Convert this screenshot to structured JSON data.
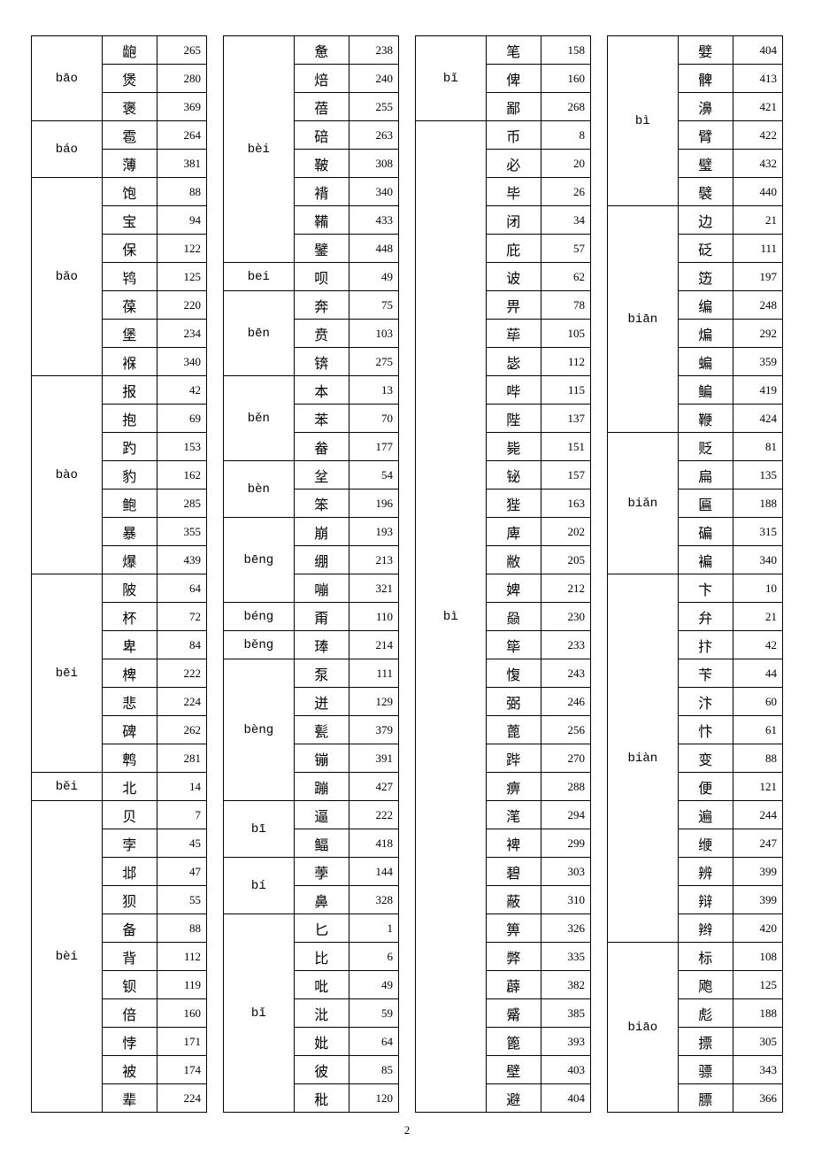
{
  "page_number": "2",
  "columns": [
    {
      "groups": [
        {
          "pinyin": "bāo",
          "entries": [
            [
              "龅",
              "265"
            ],
            [
              "煲",
              "280"
            ],
            [
              "褒",
              "369"
            ]
          ]
        },
        {
          "pinyin": "báo",
          "entries": [
            [
              "雹",
              "264"
            ],
            [
              "薄",
              "381"
            ]
          ]
        },
        {
          "pinyin": "bǎo",
          "entries": [
            [
              "饱",
              "88"
            ],
            [
              "宝",
              "94"
            ],
            [
              "保",
              "122"
            ],
            [
              "鸨",
              "125"
            ],
            [
              "葆",
              "220"
            ],
            [
              "堡",
              "234"
            ],
            [
              "褓",
              "340"
            ]
          ]
        },
        {
          "pinyin": "bào",
          "entries": [
            [
              "报",
              "42"
            ],
            [
              "抱",
              "69"
            ],
            [
              "趵",
              "153"
            ],
            [
              "豹",
              "162"
            ],
            [
              "鲍",
              "285"
            ],
            [
              "暴",
              "355"
            ],
            [
              "爆",
              "439"
            ]
          ]
        },
        {
          "pinyin": "bēi",
          "entries": [
            [
              "陂",
              "64"
            ],
            [
              "杯",
              "72"
            ],
            [
              "卑",
              "84"
            ],
            [
              "椑",
              "222"
            ],
            [
              "悲",
              "224"
            ],
            [
              "碑",
              "262"
            ],
            [
              "鹎",
              "281"
            ]
          ]
        },
        {
          "pinyin": "běi",
          "entries": [
            [
              "北",
              "14"
            ]
          ]
        },
        {
          "pinyin": "bèi",
          "entries": [
            [
              "贝",
              "7"
            ],
            [
              "孛",
              "45"
            ],
            [
              "邶",
              "47"
            ],
            [
              "狈",
              "55"
            ],
            [
              "备",
              "88"
            ],
            [
              "背",
              "112"
            ],
            [
              "钡",
              "119"
            ],
            [
              "倍",
              "160"
            ],
            [
              "悖",
              "171"
            ],
            [
              "被",
              "174"
            ],
            [
              "辈",
              "224"
            ]
          ]
        }
      ]
    },
    {
      "groups": [
        {
          "pinyin": "bèi",
          "entries": [
            [
              "惫",
              "238"
            ],
            [
              "焙",
              "240"
            ],
            [
              "蓓",
              "255"
            ],
            [
              "碚",
              "263"
            ],
            [
              "鞁",
              "308"
            ],
            [
              "褙",
              "340"
            ],
            [
              "鞴",
              "433"
            ],
            [
              "鐾",
              "448"
            ]
          ]
        },
        {
          "pinyin": "bei",
          "entries": [
            [
              "呗",
              "49"
            ]
          ]
        },
        {
          "pinyin": "bēn",
          "entries": [
            [
              "奔",
              "75"
            ],
            [
              "贲",
              "103"
            ],
            [
              "锛",
              "275"
            ]
          ]
        },
        {
          "pinyin": "běn",
          "entries": [
            [
              "本",
              "13"
            ],
            [
              "苯",
              "70"
            ],
            [
              "畚",
              "177"
            ]
          ]
        },
        {
          "pinyin": "bèn",
          "entries": [
            [
              "坌",
              "54"
            ],
            [
              "笨",
              "196"
            ]
          ]
        },
        {
          "pinyin": "bēng",
          "entries": [
            [
              "崩",
              "193"
            ],
            [
              "绷",
              "213"
            ],
            [
              "嘣",
              "321"
            ]
          ]
        },
        {
          "pinyin": "béng",
          "entries": [
            [
              "甭",
              "110"
            ]
          ]
        },
        {
          "pinyin": "běng",
          "entries": [
            [
              "琫",
              "214"
            ]
          ]
        },
        {
          "pinyin": "bèng",
          "entries": [
            [
              "泵",
              "111"
            ],
            [
              "迸",
              "129"
            ],
            [
              "甏",
              "379"
            ],
            [
              "镚",
              "391"
            ],
            [
              "蹦",
              "427"
            ]
          ]
        },
        {
          "pinyin": "bī",
          "entries": [
            [
              "逼",
              "222"
            ],
            [
              "鲾",
              "418"
            ]
          ]
        },
        {
          "pinyin": "bí",
          "entries": [
            [
              "荸",
              "144"
            ],
            [
              "鼻",
              "328"
            ]
          ]
        },
        {
          "pinyin": "bǐ",
          "entries": [
            [
              "匕",
              "1"
            ],
            [
              "比",
              "6"
            ],
            [
              "吡",
              "49"
            ],
            [
              "沘",
              "59"
            ],
            [
              "妣",
              "64"
            ],
            [
              "彼",
              "85"
            ],
            [
              "秕",
              "120"
            ]
          ]
        }
      ]
    },
    {
      "groups": [
        {
          "pinyin": "bǐ",
          "entries": [
            [
              "笔",
              "158"
            ],
            [
              "俾",
              "160"
            ],
            [
              "鄙",
              "268"
            ]
          ]
        },
        {
          "pinyin": "bì",
          "entries": [
            [
              "币",
              "8"
            ],
            [
              "必",
              "20"
            ],
            [
              "毕",
              "26"
            ],
            [
              "闭",
              "34"
            ],
            [
              "庇",
              "57"
            ],
            [
              "诐",
              "62"
            ],
            [
              "畀",
              "78"
            ],
            [
              "荜",
              "105"
            ],
            [
              "毖",
              "112"
            ],
            [
              "哔",
              "115"
            ],
            [
              "陛",
              "137"
            ],
            [
              "毙",
              "151"
            ],
            [
              "铋",
              "157"
            ],
            [
              "狴",
              "163"
            ],
            [
              "庳",
              "202"
            ],
            [
              "敝",
              "205"
            ],
            [
              "婢",
              "212"
            ],
            [
              "赑",
              "230"
            ],
            [
              "筚",
              "233"
            ],
            [
              "愎",
              "243"
            ],
            [
              "弼",
              "246"
            ],
            [
              "蓖",
              "256"
            ],
            [
              "跸",
              "270"
            ],
            [
              "痹",
              "288"
            ],
            [
              "滗",
              "294"
            ],
            [
              "裨",
              "299"
            ],
            [
              "碧",
              "303"
            ],
            [
              "蔽",
              "310"
            ],
            [
              "箅",
              "326"
            ],
            [
              "弊",
              "335"
            ],
            [
              "薜",
              "382"
            ],
            [
              "觱",
              "385"
            ],
            [
              "篦",
              "393"
            ],
            [
              "壁",
              "403"
            ],
            [
              "避",
              "404"
            ]
          ]
        }
      ]
    },
    {
      "groups": [
        {
          "pinyin": "bì",
          "entries": [
            [
              "嬖",
              "404"
            ],
            [
              "髀",
              "413"
            ],
            [
              "濞",
              "421"
            ],
            [
              "臂",
              "422"
            ],
            [
              "璧",
              "432"
            ],
            [
              "襞",
              "440"
            ]
          ]
        },
        {
          "pinyin": "biān",
          "entries": [
            [
              "边",
              "21"
            ],
            [
              "砭",
              "111"
            ],
            [
              "笾",
              "197"
            ],
            [
              "编",
              "248"
            ],
            [
              "煸",
              "292"
            ],
            [
              "蝙",
              "359"
            ],
            [
              "鳊",
              "419"
            ],
            [
              "鞭",
              "424"
            ]
          ]
        },
        {
          "pinyin": "biǎn",
          "entries": [
            [
              "贬",
              "81"
            ],
            [
              "扁",
              "135"
            ],
            [
              "匾",
              "188"
            ],
            [
              "碥",
              "315"
            ],
            [
              "褊",
              "340"
            ]
          ]
        },
        {
          "pinyin": "biàn",
          "entries": [
            [
              "卞",
              "10"
            ],
            [
              "弁",
              "21"
            ],
            [
              "抃",
              "42"
            ],
            [
              "苄",
              "44"
            ],
            [
              "汴",
              "60"
            ],
            [
              "忭",
              "61"
            ],
            [
              "变",
              "88"
            ],
            [
              "便",
              "121"
            ],
            [
              "遍",
              "244"
            ],
            [
              "缏",
              "247"
            ],
            [
              "辨",
              "399"
            ],
            [
              "辩",
              "399"
            ],
            [
              "辫",
              "420"
            ]
          ]
        },
        {
          "pinyin": "biāo",
          "entries": [
            [
              "标",
              "108"
            ],
            [
              "飑",
              "125"
            ],
            [
              "彪",
              "188"
            ],
            [
              "摽",
              "305"
            ],
            [
              "骠",
              "343"
            ],
            [
              "膘",
              "366"
            ]
          ]
        }
      ]
    }
  ]
}
